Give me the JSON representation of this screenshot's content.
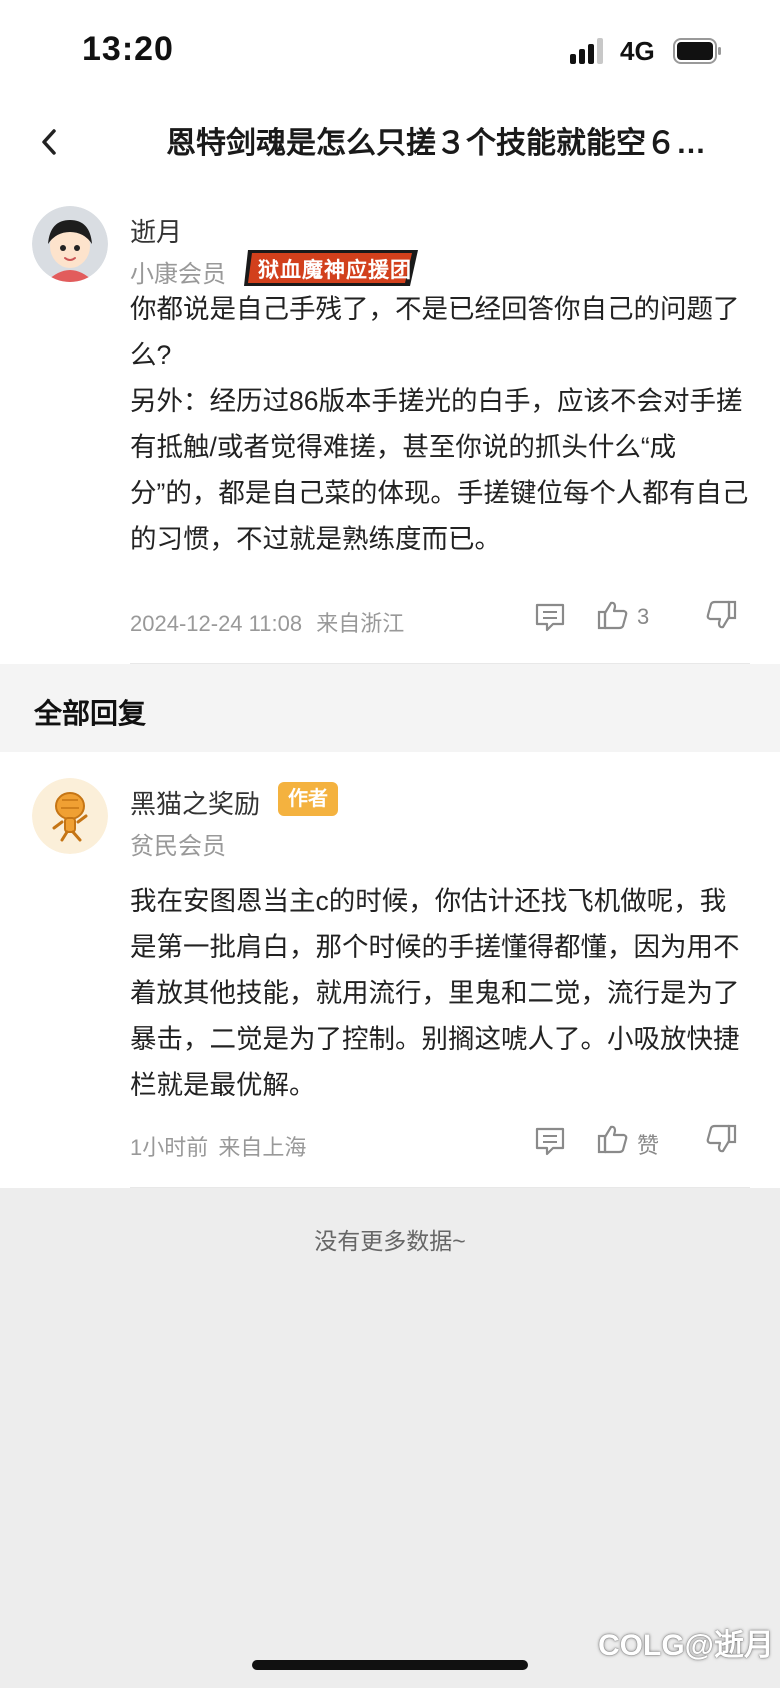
{
  "status_bar": {
    "time": "13:20",
    "network": "4G"
  },
  "nav": {
    "title": "恩特剑魂是怎么只搓３个技能就能空６…"
  },
  "post": {
    "author": "逝月",
    "level": "小康会员",
    "fan_badge": "狱血魔神应援团",
    "content": [
      "你都说是自己手残了，不是已经回答你自己的问题了么?",
      "另外：经历过86版本手搓光的白手，应该不会对手搓有抵触/或者觉得难搓，甚至你说的抓头什么“成分”的，都是自己菜的体现。手搓键位每个人都有自己的习惯，不过就是熟练度而已。"
    ],
    "timestamp": "2024-12-24 11:08",
    "location": "来自浙江",
    "like_count": "3"
  },
  "section": {
    "title": "全部回复"
  },
  "reply": {
    "author": "黑猫之奖励",
    "author_badge": "作者",
    "level": "贫民会员",
    "content": "我在安图恩当主c的时候，你估计还找飞机做呢，我是第一批肩白，那个时候的手搓懂得都懂，因为用不着放其他技能，就用流行，里鬼和二觉，流行是为了暴击，二觉是为了控制。别搁这唬人了。小吸放快捷栏就是最优解。",
    "timestamp": "1小时前",
    "location": "来自上海",
    "like_label": "赞"
  },
  "footer": {
    "no_more": "没有更多数据~",
    "watermark": "COLG@逝月"
  },
  "colors": {
    "author_badge": "#f4b23f",
    "fan_badge_bg": "#d2401c",
    "page_bg": "#ededed"
  }
}
